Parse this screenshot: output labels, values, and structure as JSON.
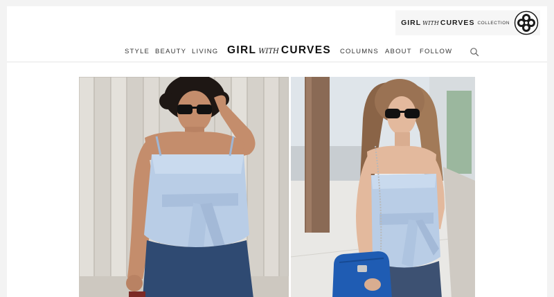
{
  "collection": {
    "brand_main": "GIRL",
    "brand_with": "WITH",
    "brand_end": "CURVES",
    "suffix": "COLLECTION",
    "emblem_icon": "quatrefoil-emblem-icon"
  },
  "nav": {
    "left_items": [
      "STYLE",
      "BEAUTY",
      "LIVING"
    ],
    "logo": {
      "main": "GIRL",
      "with": "WITH",
      "end": "CURVES"
    },
    "right_items": [
      "COLUMNS",
      "ABOUT",
      "FOLLOW"
    ],
    "search_icon": "search-icon"
  },
  "photos": {
    "left": "photo-woman-curly-hair-sunglasses",
    "right": "photo-woman-long-hair-blue-bag"
  },
  "colors": {
    "top_blue": "#b9cde6",
    "denim": "#2f4a72",
    "bag_blue": "#1f5cb3"
  }
}
